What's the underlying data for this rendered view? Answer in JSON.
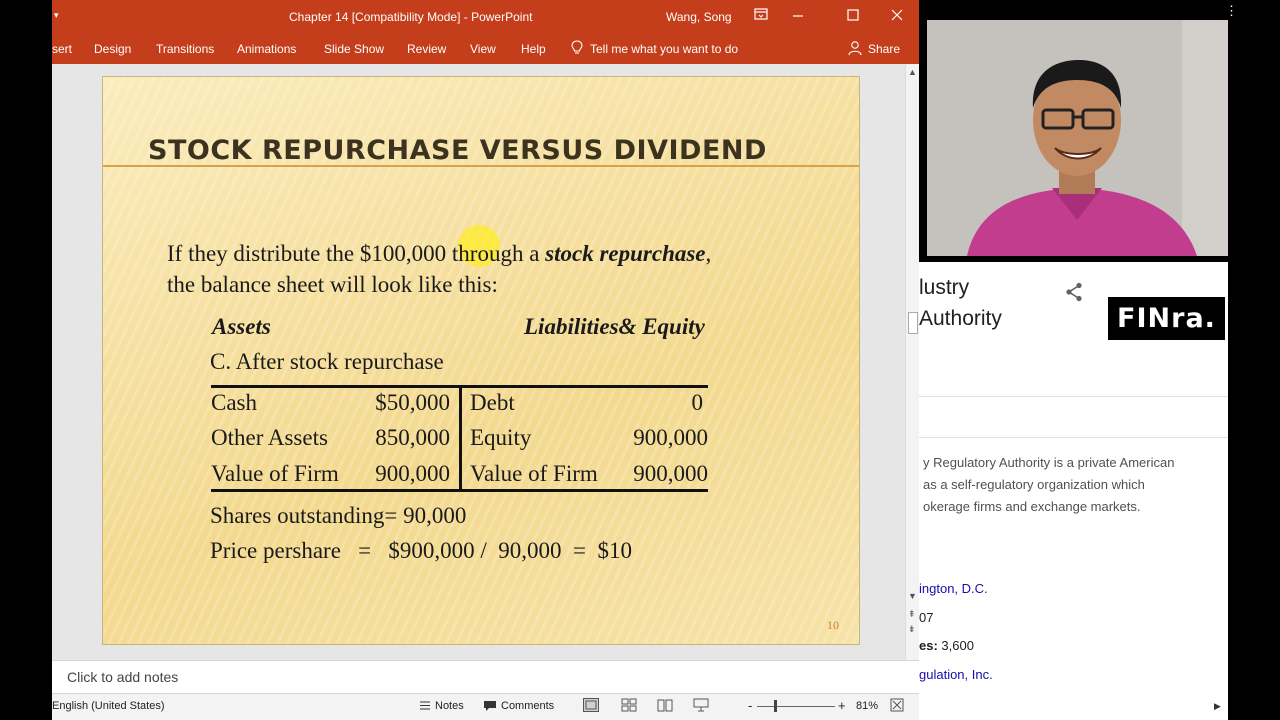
{
  "window": {
    "qat_glyph": "▾",
    "title": "Chapter 14 [Compatibility Mode]  -  PowerPoint",
    "user": "Wang, Song"
  },
  "ribbon": {
    "tabs": [
      "sert",
      "Design",
      "Transitions",
      "Animations",
      "Slide Show",
      "Review",
      "View",
      "Help"
    ],
    "tell_me": "Tell me what you want to do",
    "share": "Share"
  },
  "slide": {
    "title": "STOCK REPURCHASE VERSUS DIVIDEND",
    "intro_line1_a": "If they distribute the $100,000 through a ",
    "intro_line1_b": "stock repurchase",
    "intro_line1_c": ",",
    "intro_line2": "the balance sheet will look like this:",
    "assets_header": "Assets",
    "liab_header": "Liabilities& Equity",
    "section_label": "C.  After stock repurchase",
    "left_rows": [
      {
        "label": "Cash",
        "value": "$50,000"
      },
      {
        "label": "Other Assets",
        "value": "850,000"
      },
      {
        "label": "Value of Firm",
        "value": "900,000"
      }
    ],
    "right_rows": [
      {
        "label": "Debt",
        "value": "0"
      },
      {
        "label": "Equity",
        "value": "900,000"
      },
      {
        "label": "Value of Firm",
        "value": "900,000"
      }
    ],
    "shares_line": "Shares outstanding=  90,000",
    "price_line": "Price pershare   =   $900,000 /  90,000  =  $10",
    "page_number": "10",
    "accent_color": "#d8a24a"
  },
  "notes": {
    "placeholder": "Click to add notes"
  },
  "status": {
    "language": "English (United States)",
    "notes_label": "Notes",
    "comments_label": "Comments",
    "zoom_minus": "-",
    "zoom_plus": "+",
    "zoom": "81%"
  },
  "right_panel": {
    "title_line1": "lustry",
    "title_line2": "Authority",
    "logo_text": "FINra.",
    "desc_line1": "y Regulatory Authority is a private American",
    "desc_line2": " as a self-regulatory organization which",
    "desc_line3": "okerage firms and exchange markets.",
    "fact1": "ington, D.C.",
    "fact2": "07",
    "fact3_key": "es: ",
    "fact3_val": "3,600",
    "fact4": "gulation, Inc."
  }
}
